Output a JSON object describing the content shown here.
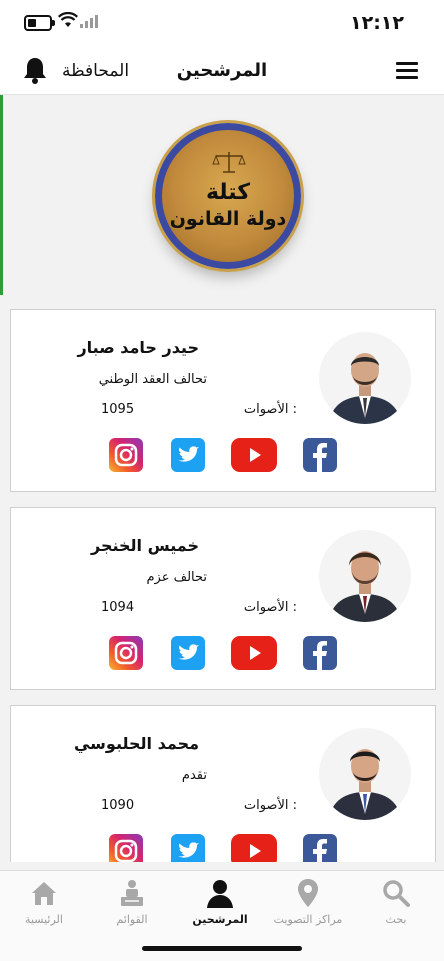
{
  "status_bar": {
    "time": "١٢:١٢"
  },
  "header": {
    "title": "المرشحين",
    "governorate_label": "المحافظة"
  },
  "banner": {
    "logo_line1": "كتلة",
    "logo_line2": "دولة القانون"
  },
  "candidates": [
    {
      "name": "حيدر حامد صبار",
      "party": "تحالف العقد الوطني",
      "votes_label": "الأصوات :",
      "votes": "1095"
    },
    {
      "name": "خميس الخنجر",
      "party": "تحالف عزم",
      "votes_label": "الأصوات :",
      "votes": "1094"
    },
    {
      "name": "محمد الحلبوسي",
      "party": "تقدم",
      "votes_label": "الأصوات :",
      "votes": "1090"
    }
  ],
  "social_icons": [
    "instagram-icon",
    "twitter-icon",
    "youtube-icon",
    "facebook-icon"
  ],
  "tabbar": {
    "tabs": [
      {
        "label": "الرئيسية",
        "icon": "home-icon"
      },
      {
        "label": "القوائم",
        "icon": "lists-icon"
      },
      {
        "label": "المرشحين",
        "icon": "candidates-icon"
      },
      {
        "label": "مراكز التصويت",
        "icon": "location-pin-icon"
      },
      {
        "label": "بحث",
        "icon": "search-icon"
      }
    ],
    "active": "المرشحين"
  },
  "colors": {
    "accent_green": "#2e9b3a",
    "youtube": "#e62117",
    "twitter": "#1da1f2",
    "facebook": "#3b5998"
  }
}
